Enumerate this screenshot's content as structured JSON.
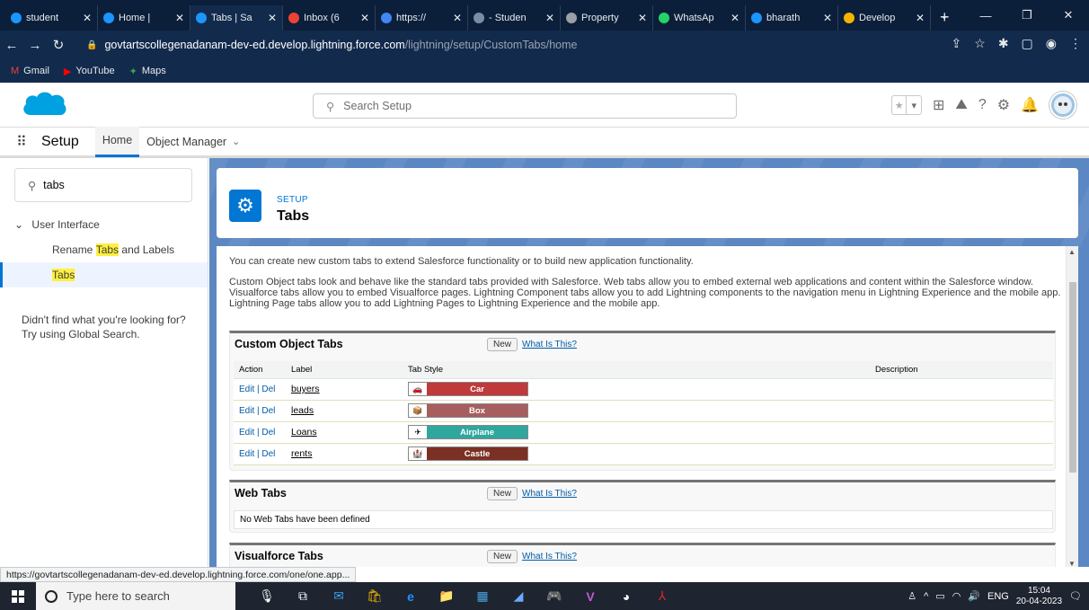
{
  "browser": {
    "tabs": [
      {
        "title": "student",
        "color": "#1b96ff",
        "active": false
      },
      {
        "title": "Home | ",
        "color": "#1b96ff",
        "active": false
      },
      {
        "title": "Tabs | Sa",
        "color": "#1b96ff",
        "active": true
      },
      {
        "title": "Inbox (6",
        "color": "#ea4335",
        "active": false
      },
      {
        "title": "https://",
        "color": "#4285f4",
        "active": false
      },
      {
        "title": "- Studen",
        "color": "#7a8da8",
        "active": false
      },
      {
        "title": "Property",
        "color": "#9aa0a6",
        "active": false
      },
      {
        "title": "WhatsAp",
        "color": "#25d366",
        "active": false
      },
      {
        "title": "bharath",
        "color": "#1b96ff",
        "active": false
      },
      {
        "title": "Develop",
        "color": "#f4b400",
        "active": false
      }
    ],
    "new_tab": "+",
    "url_host": "govtartscollegenadanam-dev-ed.develop.lightning.force.com",
    "url_path": "/lightning/setup/CustomTabs/home",
    "bookmarks": [
      {
        "label": "Gmail",
        "icon": "M",
        "color": "#ea4335"
      },
      {
        "label": "YouTube",
        "icon": "▶",
        "color": "#ff0000"
      },
      {
        "label": "Maps",
        "icon": "✦",
        "color": "#34a853"
      }
    ]
  },
  "sf_header": {
    "search_placeholder": "Search Setup"
  },
  "app_nav": {
    "app_name": "Setup",
    "tabs": [
      {
        "label": "Home",
        "active": true
      },
      {
        "label": "Object Manager",
        "active": false
      }
    ]
  },
  "left_panel": {
    "quick_find_value": "tabs",
    "tree_head": "User Interface",
    "items": [
      {
        "pre": "Rename ",
        "hl": "Tabs",
        "post": " and Labels",
        "selected": false
      },
      {
        "pre": "",
        "hl": "Tabs",
        "post": "",
        "selected": true
      }
    ],
    "not_found": "Didn't find what you're looking for? Try using Global Search."
  },
  "page_header": {
    "kicker": "SETUP",
    "title": "Tabs"
  },
  "content": {
    "intro": "You can create new custom tabs to extend Salesforce functionality or to build new application functionality.",
    "desc": "Custom Object tabs look and behave like the standard tabs provided with Salesforce. Web tabs allow you to embed external web applications and content within the Salesforce window. Visualforce tabs allow you to embed Visualforce pages. Lightning Component tabs allow you to add Lightning components to the navigation menu in Lightning Experience and the mobile app. Lightning Page tabs allow you to add Lightning Pages to Lightning Experience and the mobile app.",
    "new_label": "New",
    "what_label": "What Is This?",
    "custom_object_tabs": {
      "title": "Custom Object Tabs",
      "columns": [
        "Action",
        "Label",
        "Tab Style",
        "Description"
      ],
      "action_edit": "Edit",
      "action_sep": " | ",
      "action_del": "Del",
      "rows": [
        {
          "label": "buyers",
          "style": "Car",
          "color": "#c0393b",
          "icon": "🚗"
        },
        {
          "label": "leads",
          "style": "Box",
          "color": "#a65e5e",
          "icon": "📦"
        },
        {
          "label": "Loans",
          "style": "Airplane",
          "color": "#2fa69e",
          "icon": "✈"
        },
        {
          "label": "rents",
          "style": "Castle",
          "color": "#7b3023",
          "icon": "🏰"
        }
      ]
    },
    "web_tabs": {
      "title": "Web Tabs",
      "empty": "No Web Tabs have been defined"
    },
    "visualforce_tabs": {
      "title": "Visualforce Tabs"
    }
  },
  "status_url": "https://govtartscollegenadanam-dev-ed.develop.lightning.force.com/one/one.app...",
  "taskbar": {
    "search_placeholder": "Type here to search",
    "lang": "ENG",
    "time": "15:04",
    "date": "20-04-2023"
  }
}
